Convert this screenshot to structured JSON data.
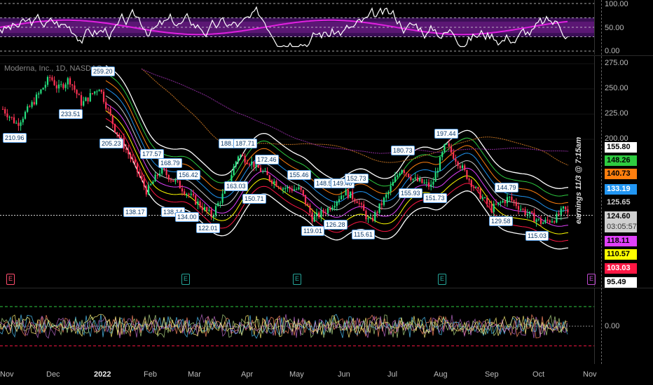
{
  "symbol": "Moderna, Inc., 1D, NASDAQ",
  "rsi_axis": [
    "100.00",
    "50.00",
    "0.00"
  ],
  "price_axis": [
    "275.00",
    "250.00",
    "225.00",
    "200.00"
  ],
  "price_tags": [
    {
      "label": "155.80",
      "bg": "#ffffff",
      "fg": "#000000"
    },
    {
      "label": "148.26",
      "bg": "#2ecc40",
      "fg": "#000000"
    },
    {
      "label": "140.73",
      "bg": "#ff7f0e",
      "fg": "#000000"
    },
    {
      "label": "133.19",
      "bg": "#2196f3",
      "fg": "#ffffff"
    },
    {
      "label": "125.65",
      "bg": "#000000",
      "fg": "#cccccc"
    },
    {
      "label": "124.60",
      "bg": "#d0d0d0",
      "fg": "#000000"
    },
    {
      "label": "03:05:57",
      "bg": "#d0d0d0",
      "fg": "#333333"
    },
    {
      "label": "118.11",
      "bg": "#e040fb",
      "fg": "#000000"
    },
    {
      "label": "110.57",
      "bg": "#ffff00",
      "fg": "#000000"
    },
    {
      "label": "103.03",
      "bg": "#ff1744",
      "fg": "#ffffff"
    },
    {
      "label": "95.49",
      "bg": "#ffffff",
      "fg": "#000000"
    }
  ],
  "osc_axis": [
    "0.00"
  ],
  "earnings_note": "earnings 11/3 @ 7:15am",
  "x_labels": [
    {
      "label": "Nov",
      "bold": false
    },
    {
      "label": "Dec",
      "bold": false
    },
    {
      "label": "2022",
      "bold": true
    },
    {
      "label": "Feb",
      "bold": false
    },
    {
      "label": "Mar",
      "bold": false
    },
    {
      "label": "Apr",
      "bold": false
    },
    {
      "label": "May",
      "bold": false
    },
    {
      "label": "Jun",
      "bold": false
    },
    {
      "label": "Jul",
      "bold": false
    },
    {
      "label": "Aug",
      "bold": false
    },
    {
      "label": "Sep",
      "bold": false
    },
    {
      "label": "Oct",
      "bold": false
    },
    {
      "label": "Nov",
      "bold": false
    }
  ],
  "price_labels": [
    "210.96",
    "233.51",
    "259.20",
    "205.23",
    "177.57",
    "168.79",
    "156.42",
    "138.17",
    "138.14",
    "134.00",
    "122.01",
    "188.01",
    "187.71",
    "163.03",
    "172.46",
    "150.71",
    "155.46",
    "148.50",
    "149.48",
    "152.73",
    "119.01",
    "126.28",
    "115.61",
    "180.73",
    "155.93",
    "151.73",
    "197.44",
    "144.79",
    "129.58",
    "115.03"
  ],
  "earnings_icon": "E",
  "colors": {
    "up": "#26e07f",
    "down": "#ff3355",
    "band": "#ffffff",
    "rsi": "#ffffff",
    "rsi_ma": "#e020e0",
    "purple_zone": "#6a1b9a"
  },
  "chart_data": {
    "type": "candlestick",
    "close_series": [
      {
        "x": "2021-10-27",
        "y": 230
      },
      {
        "x": "2021-11-05",
        "y": 215
      },
      {
        "x": "2021-11-15",
        "y": 236
      },
      {
        "x": "2021-11-26",
        "y": 262
      },
      {
        "x": "2021-12-01",
        "y": 250
      },
      {
        "x": "2021-12-08",
        "y": 260
      },
      {
        "x": "2021-12-16",
        "y": 235
      },
      {
        "x": "2021-12-27",
        "y": 252
      },
      {
        "x": "2022-01-06",
        "y": 210
      },
      {
        "x": "2022-01-18",
        "y": 175
      },
      {
        "x": "2022-01-26",
        "y": 148
      },
      {
        "x": "2022-02-04",
        "y": 170
      },
      {
        "x": "2022-02-15",
        "y": 155
      },
      {
        "x": "2022-02-25",
        "y": 140
      },
      {
        "x": "2022-03-08",
        "y": 124
      },
      {
        "x": "2022-03-17",
        "y": 150
      },
      {
        "x": "2022-03-25",
        "y": 185
      },
      {
        "x": "2022-04-04",
        "y": 175
      },
      {
        "x": "2022-04-13",
        "y": 162
      },
      {
        "x": "2022-04-22",
        "y": 152
      },
      {
        "x": "2022-05-03",
        "y": 150
      },
      {
        "x": "2022-05-11",
        "y": 121
      },
      {
        "x": "2022-05-20",
        "y": 130
      },
      {
        "x": "2022-05-31",
        "y": 148
      },
      {
        "x": "2022-06-08",
        "y": 140
      },
      {
        "x": "2022-06-16",
        "y": 117
      },
      {
        "x": "2022-06-27",
        "y": 145
      },
      {
        "x": "2022-07-06",
        "y": 172
      },
      {
        "x": "2022-07-14",
        "y": 160
      },
      {
        "x": "2022-07-25",
        "y": 153
      },
      {
        "x": "2022-08-03",
        "y": 195
      },
      {
        "x": "2022-08-12",
        "y": 175
      },
      {
        "x": "2022-08-22",
        "y": 150
      },
      {
        "x": "2022-09-01",
        "y": 131
      },
      {
        "x": "2022-09-12",
        "y": 142
      },
      {
        "x": "2022-09-22",
        "y": 128
      },
      {
        "x": "2022-10-03",
        "y": 117
      },
      {
        "x": "2022-10-12",
        "y": 122
      },
      {
        "x": "2022-10-17",
        "y": 131
      },
      {
        "x": "2022-10-20",
        "y": 124.6
      }
    ],
    "last_price": 124.6,
    "ylim": [
      95,
      280
    ],
    "band_levels": [
      155.8,
      148.26,
      140.73,
      133.19,
      125.65,
      118.11,
      110.57,
      103.03,
      95.49
    ],
    "rsi_ylim": [
      0,
      100
    ],
    "rsi_levels": [
      100,
      50,
      0
    ]
  }
}
